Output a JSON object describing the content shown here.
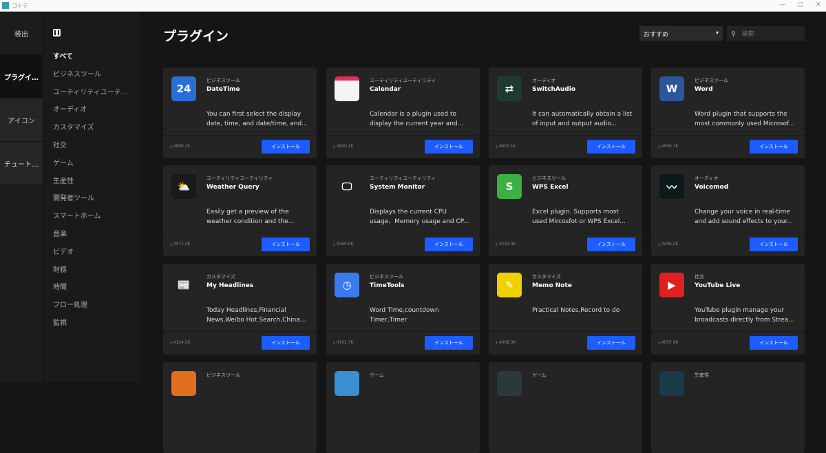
{
  "window": {
    "title": "コトテ",
    "min": "—",
    "max": "▢",
    "close": "✕"
  },
  "rail": [
    {
      "label": "検出"
    },
    {
      "label": "プラグイ…"
    },
    {
      "label": "アイコン"
    },
    {
      "label": "チュート…"
    }
  ],
  "categories": [
    "すべて",
    "ビジネスツール",
    "ユーティリティユーテ…",
    "オーディオ",
    "カスタマイズ",
    "社交",
    "ゲーム",
    "生産性",
    "開発者ツール",
    "スマートホーム",
    "音楽",
    "ビデオ",
    "財務",
    "時間",
    "フロー処理",
    "監視"
  ],
  "header": {
    "title": "プラグイン",
    "sort_value": "おすすめ",
    "sort_caret": "▾",
    "search_placeholder": "検索",
    "search_icon": "⚲"
  },
  "install_label": "インストール",
  "plugins": [
    {
      "category": "ビジネスツール",
      "name": "DateTime",
      "desc": "You can first select the display date, time, and date/time, and...",
      "downloads": "4990.2K",
      "icon": "calendar-24-icon",
      "glyph": "24",
      "color": "#2b6fd6"
    },
    {
      "category": "ユーティリティユーティリティ",
      "name": "Calendar",
      "desc": "Calendar is a plugin used to display the current year and...",
      "downloads": "4600.1K",
      "icon": "calendar-icon",
      "glyph": "",
      "color": "#f4f4f4"
    },
    {
      "category": "オーディオ",
      "name": "SwitchAudio",
      "desc": "It can automatically obtain a list of input and output audio...",
      "downloads": "4600.1K",
      "icon": "switch-audio-icon",
      "glyph": "⇄",
      "color": "#1f3a33"
    },
    {
      "category": "ビジネスツール",
      "name": "Word",
      "desc": "Word plugin that supports the most commonly used Microsof...",
      "downloads": "4500.1K",
      "icon": "word-icon",
      "glyph": "W",
      "color": "#2b579a"
    },
    {
      "category": "ユーティリティユーティリティ",
      "name": "Weather Query",
      "desc": "Easily get a preview of the weather condition and the...",
      "downloads": "4471.4K",
      "icon": "weather-icon",
      "glyph": "⛅",
      "color": "#1a1a1a"
    },
    {
      "category": "ユーティリティユーティリティ",
      "name": "System Monitor",
      "desc": "Displays the current CPU usage、Memory usage and CP...",
      "downloads": "4360.0K",
      "icon": "monitor-icon",
      "glyph": "🖵",
      "color": "#242424"
    },
    {
      "category": "ビジネスツール",
      "name": "WPS Excel",
      "desc": "Excel plugin. Supports most used Mircosfot or WPS Excel...",
      "downloads": "4233.3K",
      "icon": "excel-icon",
      "glyph": "S",
      "color": "#3cb043"
    },
    {
      "category": "オーディオ",
      "name": "Voicemod",
      "desc": "Change your voice in real-time and add sound effects to your...",
      "downloads": "4206.2K",
      "icon": "voicemod-icon",
      "glyph": "〰",
      "color": "#0d1a1a"
    },
    {
      "category": "カスタマイズ",
      "name": "My Headlines",
      "desc": "Today Headlines,Financial News,Weibo Hot Search,China...",
      "downloads": "4124.2K",
      "icon": "newspaper-icon",
      "glyph": "📰",
      "color": "#242424"
    },
    {
      "category": "ビジネスツール",
      "name": "TimeTools",
      "desc": "Word Time,countdown Timer,Timer",
      "downloads": "4101.7K",
      "icon": "clock-icon",
      "glyph": "◷",
      "color": "#3a7bf0"
    },
    {
      "category": "カスタマイズ",
      "name": "Memo Note",
      "desc": "Practical Notes,Record to do",
      "downloads": "4008.3K",
      "icon": "memo-icon",
      "glyph": "✎",
      "color": "#f0d000"
    },
    {
      "category": "社交",
      "name": "YouTube Live",
      "desc": "YouTube plugin manage your broadcasts directly from Strea...",
      "downloads": "4053.9K",
      "icon": "youtube-icon",
      "glyph": "▶",
      "color": "#e02020"
    },
    {
      "category": "ビジネスツール",
      "name": "",
      "desc": "",
      "downloads": "",
      "icon": "plugin-icon",
      "glyph": "",
      "color": "#e07020"
    },
    {
      "category": "ゲーム",
      "name": "",
      "desc": "",
      "downloads": "",
      "icon": "game-icon",
      "glyph": "",
      "color": "#3a8fd0"
    },
    {
      "category": "ゲーム",
      "name": "",
      "desc": "",
      "downloads": "",
      "icon": "game-character-icon",
      "glyph": "",
      "color": "#2a3a3a"
    },
    {
      "category": "生産性",
      "name": "",
      "desc": "",
      "downloads": "",
      "icon": "productivity-icon",
      "glyph": "",
      "color": "#1a3a4a"
    }
  ]
}
